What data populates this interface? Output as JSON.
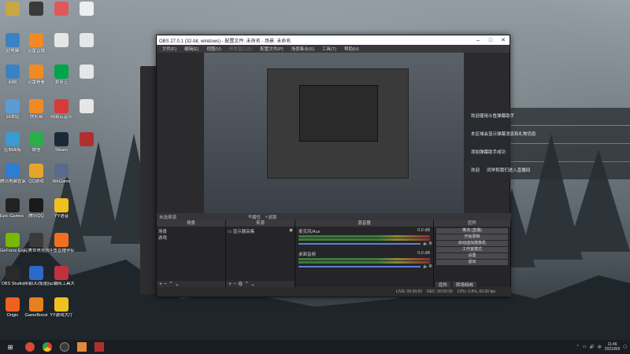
{
  "desktop_icons": [
    {
      "label": "",
      "icon": "folder-icon",
      "color": "#c9a646",
      "col": 0,
      "row": 0
    },
    {
      "label": "",
      "icon": "app-icon",
      "color": "#3a3a3a",
      "col": 1,
      "row": 0
    },
    {
      "label": "",
      "icon": "browser-icon",
      "color": "#e0585a",
      "col": 2,
      "row": 0
    },
    {
      "label": "",
      "icon": "file-icon",
      "color": "#eeeeee",
      "col": 3,
      "row": 0
    },
    {
      "label": "此电脑",
      "icon": "computer-icon",
      "color": "#3b82c4",
      "col": 0,
      "row": 1
    },
    {
      "label": "迅雷直播",
      "icon": "thunder-icon",
      "color": "#f08a24",
      "col": 1,
      "row": 1
    },
    {
      "label": "",
      "icon": "file-icon",
      "color": "#e6e6e6",
      "col": 2,
      "row": 1
    },
    {
      "label": "",
      "icon": "file-icon",
      "color": "#e6e6e6",
      "col": 3,
      "row": 1
    },
    {
      "label": "网络",
      "icon": "network-icon",
      "color": "#3b82c4",
      "col": 0,
      "row": 2
    },
    {
      "label": "迅雷看看",
      "icon": "thunder-icon",
      "color": "#f08a24",
      "col": 1,
      "row": 2
    },
    {
      "label": "爱奇艺",
      "icon": "iqiyi-icon",
      "color": "#00a44a",
      "col": 2,
      "row": 2
    },
    {
      "label": "",
      "icon": "file-icon",
      "color": "#e6e6e6",
      "col": 3,
      "row": 2
    },
    {
      "label": "回收站",
      "icon": "recycle-icon",
      "color": "#5a9bd5",
      "col": 0,
      "row": 3
    },
    {
      "label": "快剪辑",
      "icon": "edit-icon",
      "color": "#f08a24",
      "col": 1,
      "row": 3
    },
    {
      "label": "网易云音乐",
      "icon": "music-icon",
      "color": "#d83a3a",
      "col": 2,
      "row": 3
    },
    {
      "label": "",
      "icon": "file-icon",
      "color": "#e6e6e6",
      "col": 3,
      "row": 3
    },
    {
      "label": "控制面板",
      "icon": "control-panel-icon",
      "color": "#3b9ad0",
      "col": 0,
      "row": 4
    },
    {
      "label": "微信",
      "icon": "wechat-icon",
      "color": "#2aae4a",
      "col": 1,
      "row": 4
    },
    {
      "label": "Steam",
      "icon": "steam-icon",
      "color": "#1b2838",
      "col": 2,
      "row": 4
    },
    {
      "label": "",
      "icon": "game-icon",
      "color": "#b03030",
      "col": 3,
      "row": 4
    },
    {
      "label": "腾讯电脑管家",
      "icon": "shield-icon",
      "color": "#2d7dd2",
      "col": 0,
      "row": 5
    },
    {
      "label": "QQ游戏",
      "icon": "game-icon",
      "color": "#e6a52a",
      "col": 1,
      "row": 5
    },
    {
      "label": "WeGame",
      "icon": "wegame-icon",
      "color": "#5a6a8a",
      "col": 2,
      "row": 5
    },
    {
      "label": "Epic Games Launcher",
      "icon": "epic-icon",
      "color": "#222222",
      "col": 0,
      "row": 6
    },
    {
      "label": "腾讯QQ",
      "icon": "qq-icon",
      "color": "#1a1a1a",
      "col": 1,
      "row": 6
    },
    {
      "label": "YY语音",
      "icon": "yy-icon",
      "color": "#f0c020",
      "col": 2,
      "row": 6
    },
    {
      "label": "GeForce Experience",
      "icon": "nvidia-icon",
      "color": "#76b900",
      "col": 0,
      "row": 7
    },
    {
      "label": "完美世界竞技平台",
      "icon": "game-icon",
      "color": "#3a3a3a",
      "col": 1,
      "row": 7
    },
    {
      "label": "斗鱼直播伴侣",
      "icon": "douyu-icon",
      "color": "#f07020",
      "col": 2,
      "row": 7
    },
    {
      "label": "OBS Studio",
      "icon": "obs-icon",
      "color": "#2a2a2a",
      "col": 0,
      "row": 8
    },
    {
      "label": "网易UU加速器",
      "icon": "uu-icon",
      "color": "#2a6ac8",
      "col": 1,
      "row": 8
    },
    {
      "label": "云端网工具大本营直播助手",
      "icon": "app-icon",
      "color": "#c03040",
      "col": 2,
      "row": 8
    },
    {
      "label": "Origin",
      "icon": "origin-icon",
      "color": "#f06020",
      "col": 0,
      "row": 9
    },
    {
      "label": "GameBoost",
      "icon": "boost-icon",
      "color": "#e88020",
      "col": 1,
      "row": 9
    },
    {
      "label": "YY游戏大厅",
      "icon": "yy-icon",
      "color": "#f0c020",
      "col": 2,
      "row": 9
    }
  ],
  "obs": {
    "title": "OBS 27.0.1 (32-bit, windows) - 配置文件: 未命名 - 场景: 未命名",
    "menu": [
      "文件(F)",
      "编辑(E)",
      "视图(V)",
      "停靠窗口(D)",
      "配置文件(P)",
      "场景集合(S)",
      "工具(T)",
      "帮助(H)"
    ],
    "preview_bar": {
      "label": "未选择源",
      "props": "属性",
      "filters": "滤镜"
    },
    "scenes": {
      "header": "场景",
      "items": [
        "场景",
        "游戏"
      ]
    },
    "sources": {
      "header": "来源",
      "items": [
        "显示器采集"
      ]
    },
    "mixer": {
      "header": "混音器",
      "channels": [
        {
          "name": "麦克风/Aux",
          "db": "0.0 dB",
          "level": 0.9
        },
        {
          "name": "桌面音频",
          "db": "0.0 dB",
          "level": 0.85
        }
      ]
    },
    "controls": {
      "header": "控件",
      "buttons": [
        "推流 (直播)",
        "开始录制",
        "启动虚拟摄像机",
        "工作室模式",
        "设置",
        "退出"
      ]
    },
    "dock_tabs": [
      "控件",
      "转场特效"
    ],
    "status": {
      "live": "LIVE: 00:00:00",
      "rec": "REC: 00:00:00",
      "cpu": "CPU: 0.8%, 60.00 fps"
    }
  },
  "notifications": [
    {
      "text": "欢迎使用斗鱼弹幕助手",
      "highlight": "",
      "rest": ""
    },
    {
      "text": "本区域会显示弹幕消息和礼物消息",
      "highlight": "",
      "rest": ""
    },
    {
      "text": "添加弹幕助手成功",
      "highlight": "",
      "rest": ""
    },
    {
      "text": "欢迎",
      "highlight": "",
      "rest": "同学和我们进入直播间"
    }
  ],
  "taskbar": {
    "start": "⊞",
    "apps": [
      "douyu-icon",
      "chrome-icon",
      "obs-icon",
      "app-icon",
      "game-icon"
    ],
    "time": "11:46",
    "date": "2021/8/9"
  }
}
